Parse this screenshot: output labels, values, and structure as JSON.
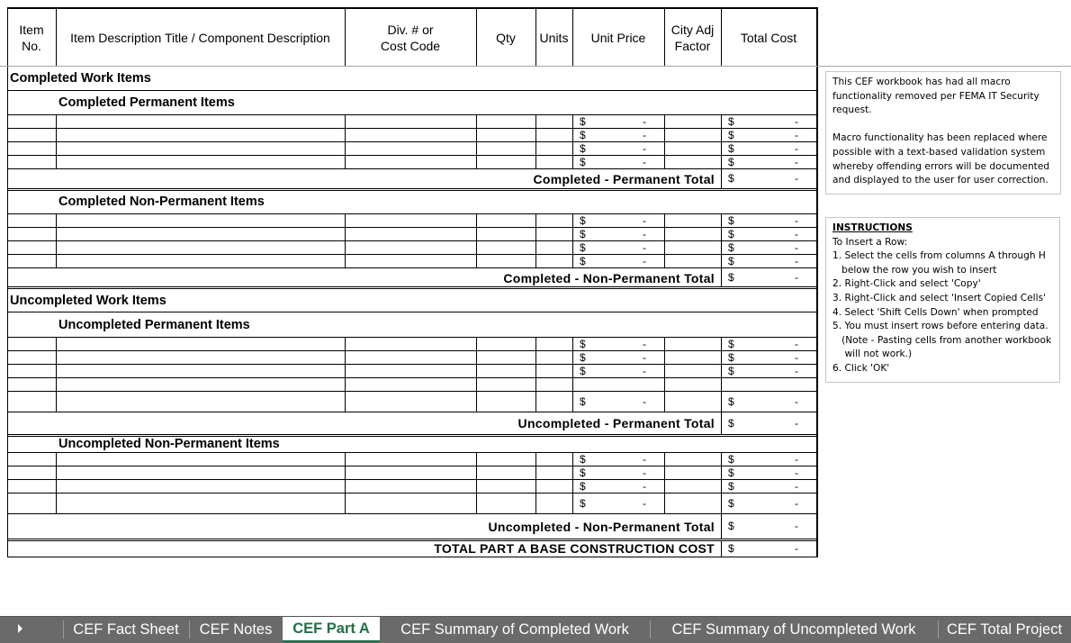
{
  "columns": {
    "item_no": "Item\nNo.",
    "description": "Item Description Title / Component Description",
    "div_code": "Div. # or\nCost Code",
    "qty": "Qty",
    "units": "Units",
    "unit_price": "Unit Price",
    "city_adj": "City Adj\nFactor",
    "total_cost": "Total Cost"
  },
  "currency_symbol": "$",
  "empty_value": "-",
  "sections": {
    "completed": {
      "title": "Completed Work Items",
      "permanent": {
        "title": "Completed Permanent Items",
        "total_label": "Completed - Permanent Total",
        "total_value": "-"
      },
      "non_permanent": {
        "title": "Completed Non-Permanent Items",
        "total_label": "Completed - Non-Permanent Total",
        "total_value": "-"
      }
    },
    "uncompleted": {
      "title": "Uncompleted Work Items",
      "permanent": {
        "title": "Uncompleted Permanent Items",
        "total_label": "Uncompleted - Permanent Total",
        "total_value": "-"
      },
      "non_permanent": {
        "title": "Uncompleted Non-Permanent Items",
        "total_label": "Uncompleted - Non-Permanent Total",
        "total_value": "-"
      }
    }
  },
  "grand_total": {
    "label": "TOTAL PART A BASE CONSTRUCTION COST",
    "value": "-"
  },
  "notes": {
    "macro_notice": [
      "This CEF workbook has had all macro functionality removed per FEMA IT Security request.",
      "Macro functionality has been replaced where possible with a text-based validation system whereby offending errors will be documented and displayed to the user for user correction."
    ],
    "instructions": {
      "heading": "INSTRUCTIONS",
      "intro": "To Insert a Row:",
      "steps": [
        "1. Select the cells from columns A through H",
        "   below the row you wish to insert",
        "2. Right-Click and select 'Copy'",
        "3. Right-Click and select 'Insert Copied Cells'",
        "4. Select 'Shift Cells Down' when prompted",
        "5. You must insert rows before entering data.",
        "   (Note - Pasting cells from another workbook",
        "    will not work.)",
        "6. Click 'OK'"
      ]
    }
  },
  "sheet_tabs": [
    {
      "label": "CEF Fact Sheet",
      "active": false
    },
    {
      "label": "CEF Notes",
      "active": false
    },
    {
      "label": "CEF Part A",
      "active": true
    },
    {
      "label": "CEF Summary of Completed Work",
      "active": false
    },
    {
      "label": "CEF Summary of Uncompleted Work",
      "active": false
    },
    {
      "label": "CEF Total Project",
      "active": false
    }
  ],
  "colors": {
    "active_tab": "#1e7145",
    "tab_bar": "#6a6a6a"
  }
}
